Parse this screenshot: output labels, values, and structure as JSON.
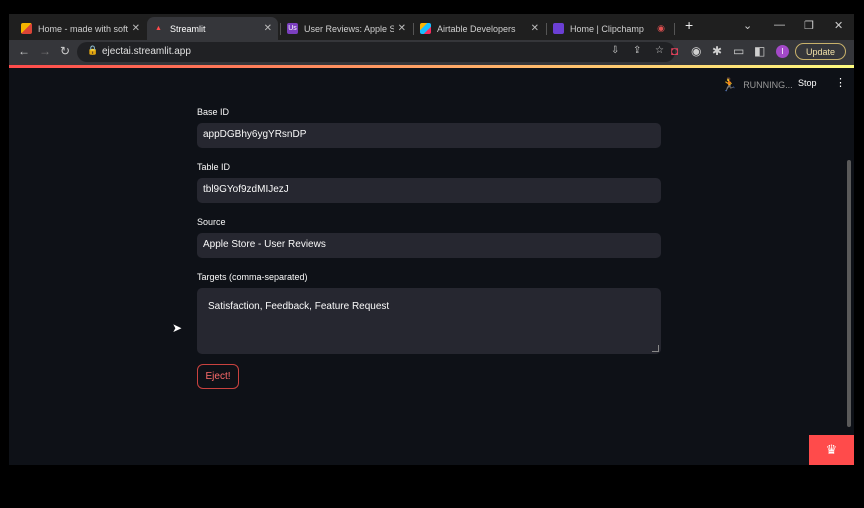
{
  "browser": {
    "tabs": [
      {
        "label": "Home - made with soft...",
        "favicon": "softr-icon",
        "active": false
      },
      {
        "label": "Streamlit",
        "favicon": "streamlit-icon",
        "active": true
      },
      {
        "label": "User Reviews: Apple Stor",
        "favicon": "us-icon",
        "active": false
      },
      {
        "label": "Airtable Developers",
        "favicon": "airtable-icon",
        "active": false
      },
      {
        "label": "Home | Clipchamp",
        "favicon": "clipchamp-icon",
        "active": false
      }
    ],
    "us_favicon_text": "Us",
    "new_tab_symbol": "+",
    "url": "ejectai.streamlit.app",
    "update_label": "Update",
    "profile_initial": "I"
  },
  "app_header": {
    "status": "RUNNING...",
    "stop_label": "Stop"
  },
  "form": {
    "base_id": {
      "label": "Base ID",
      "value": "appDGBhy6ygYRsnDP"
    },
    "table_id": {
      "label": "Table ID",
      "value": "tbl9GYof9zdMIJezJ"
    },
    "source": {
      "label": "Source",
      "value": "Apple Store - User Reviews"
    },
    "targets": {
      "label": "Targets (comma-separated)",
      "value": "Satisfaction, Feedback, Feature Request"
    },
    "submit_label": "Eject!"
  },
  "colors": {
    "accent": "#ff4b4b",
    "background": "#0e1117",
    "input_bg": "#262730"
  }
}
